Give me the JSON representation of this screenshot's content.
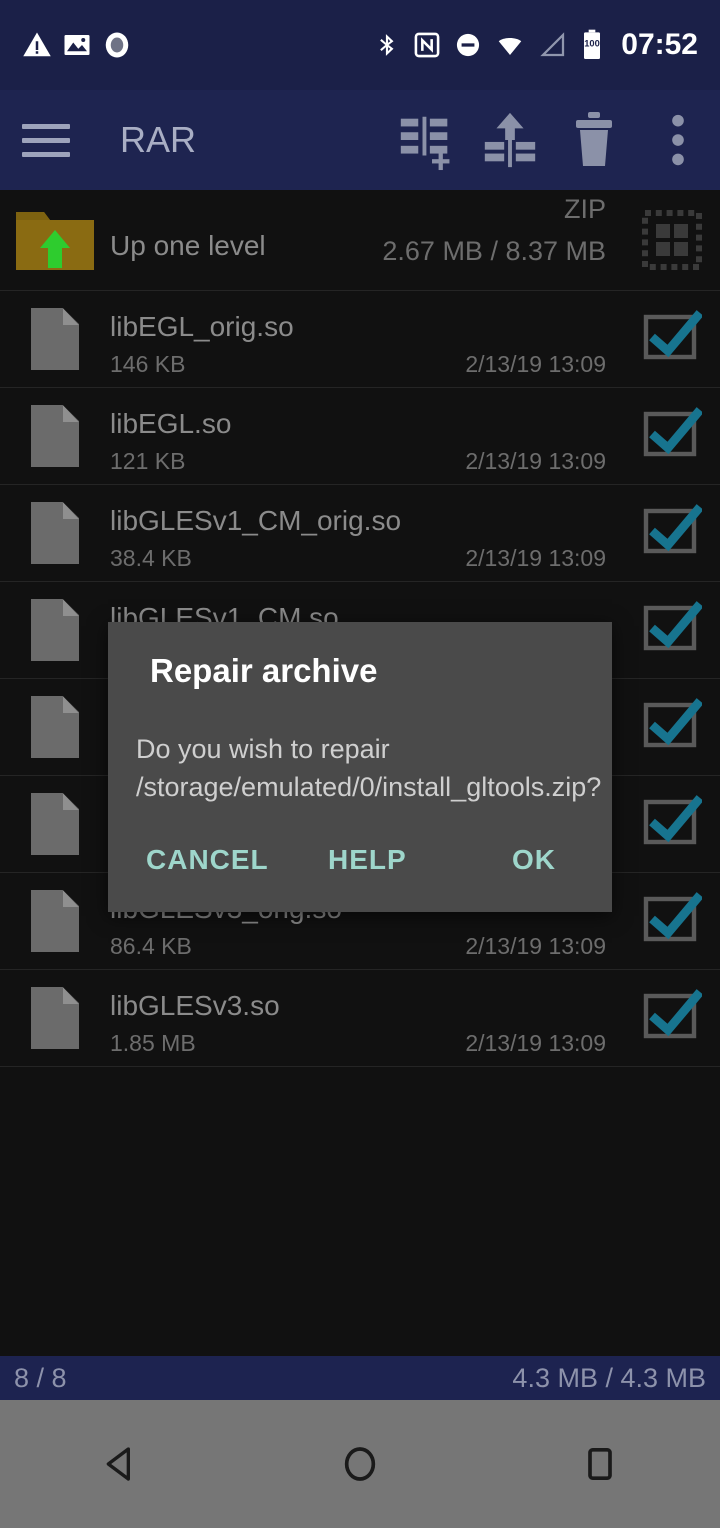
{
  "status_bar": {
    "time": "07:52",
    "battery_level": "100",
    "left_icons": [
      "warning-triangle-icon",
      "image-icon",
      "record-circle-icon"
    ],
    "right_icons": [
      "bluetooth-icon",
      "nfc-icon",
      "do-not-disturb-icon",
      "wifi-icon",
      "cell-signal-icon",
      "battery-icon"
    ]
  },
  "app_bar": {
    "title": "RAR",
    "menu_icon": "hamburger-menu-icon",
    "actions": [
      {
        "name": "add-to-archive",
        "icon": "add-to-archive-icon"
      },
      {
        "name": "extract",
        "icon": "extract-icon"
      },
      {
        "name": "delete",
        "icon": "trash-icon"
      },
      {
        "name": "overflow",
        "icon": "overflow-menu-icon"
      }
    ]
  },
  "list": {
    "up_row": {
      "label": "Up one level",
      "type": "ZIP",
      "size": "2.67 MB / 8.37 MB",
      "select_icon": "select-all-icon"
    },
    "columns": [
      "name",
      "size",
      "date"
    ],
    "files": [
      {
        "name": "libEGL_orig.so",
        "size": "146 KB",
        "date": "2/13/19 13:09",
        "checked": true
      },
      {
        "name": "libEGL.so",
        "size": "121 KB",
        "date": "2/13/19 13:09",
        "checked": true
      },
      {
        "name": "libGLESv1_CM_orig.so",
        "size": "38.4 KB",
        "date": "2/13/19 13:09",
        "checked": true
      },
      {
        "name": "libGLESv1_CM.so",
        "size": "",
        "date": "",
        "checked": true
      },
      {
        "name": "",
        "size": "",
        "date": "",
        "checked": true
      },
      {
        "name": "",
        "size": "",
        "date": "",
        "checked": true
      },
      {
        "name": "libGLESv3_orig.so",
        "size": "86.4 KB",
        "date": "2/13/19 13:09",
        "checked": true
      },
      {
        "name": "libGLESv3.so",
        "size": "1.85 MB",
        "date": "2/13/19 13:09",
        "checked": true
      }
    ]
  },
  "bottom_bar": {
    "count": "8 / 8",
    "sizes": "4.3 MB / 4.3 MB"
  },
  "dialog": {
    "title": "Repair archive",
    "message": "Do you wish to repair /storage/emulated/0/install_gltools.zip?",
    "cancel_label": "CANCEL",
    "help_label": "HELP",
    "ok_label": "OK"
  },
  "nav_bar": {
    "back": "back-triangle-icon",
    "home": "home-circle-icon",
    "recents": "recents-square-icon"
  },
  "colors": {
    "status_bar_bg": "#1b2048",
    "app_bar_bg": "#1e2450",
    "list_bg": "#111111",
    "accent_check": "#17748f",
    "dialog_bg": "#4a4a4a",
    "dialog_button": "#9ed6cb",
    "nav_bar_bg": "#767676",
    "folder_arrow": "#2ecc2e"
  }
}
